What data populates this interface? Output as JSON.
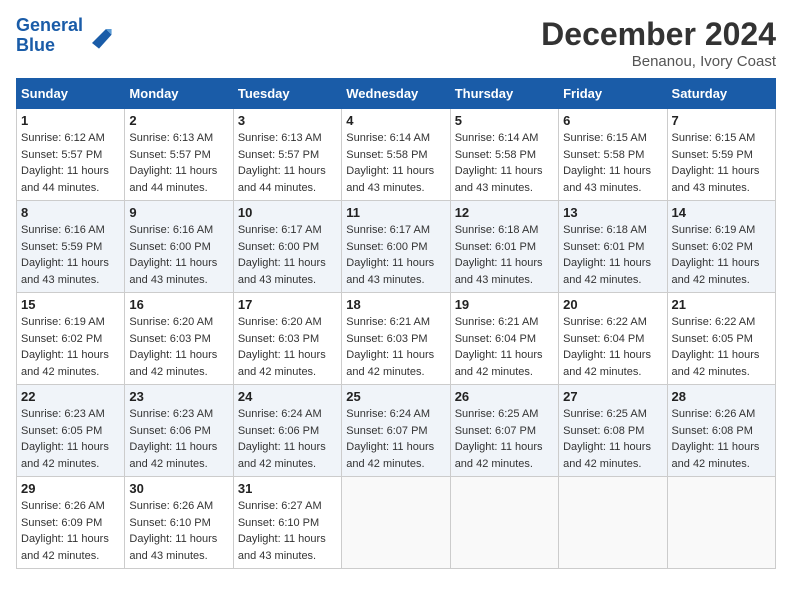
{
  "header": {
    "logo_line1": "General",
    "logo_line2": "Blue",
    "month_title": "December 2024",
    "subtitle": "Benanou, Ivory Coast"
  },
  "days_of_week": [
    "Sunday",
    "Monday",
    "Tuesday",
    "Wednesday",
    "Thursday",
    "Friday",
    "Saturday"
  ],
  "weeks": [
    [
      {
        "day": "1",
        "sunrise": "6:12 AM",
        "sunset": "5:57 PM",
        "daylight": "11 hours and 44 minutes."
      },
      {
        "day": "2",
        "sunrise": "6:13 AM",
        "sunset": "5:57 PM",
        "daylight": "11 hours and 44 minutes."
      },
      {
        "day": "3",
        "sunrise": "6:13 AM",
        "sunset": "5:57 PM",
        "daylight": "11 hours and 44 minutes."
      },
      {
        "day": "4",
        "sunrise": "6:14 AM",
        "sunset": "5:58 PM",
        "daylight": "11 hours and 43 minutes."
      },
      {
        "day": "5",
        "sunrise": "6:14 AM",
        "sunset": "5:58 PM",
        "daylight": "11 hours and 43 minutes."
      },
      {
        "day": "6",
        "sunrise": "6:15 AM",
        "sunset": "5:58 PM",
        "daylight": "11 hours and 43 minutes."
      },
      {
        "day": "7",
        "sunrise": "6:15 AM",
        "sunset": "5:59 PM",
        "daylight": "11 hours and 43 minutes."
      }
    ],
    [
      {
        "day": "8",
        "sunrise": "6:16 AM",
        "sunset": "5:59 PM",
        "daylight": "11 hours and 43 minutes."
      },
      {
        "day": "9",
        "sunrise": "6:16 AM",
        "sunset": "6:00 PM",
        "daylight": "11 hours and 43 minutes."
      },
      {
        "day": "10",
        "sunrise": "6:17 AM",
        "sunset": "6:00 PM",
        "daylight": "11 hours and 43 minutes."
      },
      {
        "day": "11",
        "sunrise": "6:17 AM",
        "sunset": "6:00 PM",
        "daylight": "11 hours and 43 minutes."
      },
      {
        "day": "12",
        "sunrise": "6:18 AM",
        "sunset": "6:01 PM",
        "daylight": "11 hours and 43 minutes."
      },
      {
        "day": "13",
        "sunrise": "6:18 AM",
        "sunset": "6:01 PM",
        "daylight": "11 hours and 42 minutes."
      },
      {
        "day": "14",
        "sunrise": "6:19 AM",
        "sunset": "6:02 PM",
        "daylight": "11 hours and 42 minutes."
      }
    ],
    [
      {
        "day": "15",
        "sunrise": "6:19 AM",
        "sunset": "6:02 PM",
        "daylight": "11 hours and 42 minutes."
      },
      {
        "day": "16",
        "sunrise": "6:20 AM",
        "sunset": "6:03 PM",
        "daylight": "11 hours and 42 minutes."
      },
      {
        "day": "17",
        "sunrise": "6:20 AM",
        "sunset": "6:03 PM",
        "daylight": "11 hours and 42 minutes."
      },
      {
        "day": "18",
        "sunrise": "6:21 AM",
        "sunset": "6:03 PM",
        "daylight": "11 hours and 42 minutes."
      },
      {
        "day": "19",
        "sunrise": "6:21 AM",
        "sunset": "6:04 PM",
        "daylight": "11 hours and 42 minutes."
      },
      {
        "day": "20",
        "sunrise": "6:22 AM",
        "sunset": "6:04 PM",
        "daylight": "11 hours and 42 minutes."
      },
      {
        "day": "21",
        "sunrise": "6:22 AM",
        "sunset": "6:05 PM",
        "daylight": "11 hours and 42 minutes."
      }
    ],
    [
      {
        "day": "22",
        "sunrise": "6:23 AM",
        "sunset": "6:05 PM",
        "daylight": "11 hours and 42 minutes."
      },
      {
        "day": "23",
        "sunrise": "6:23 AM",
        "sunset": "6:06 PM",
        "daylight": "11 hours and 42 minutes."
      },
      {
        "day": "24",
        "sunrise": "6:24 AM",
        "sunset": "6:06 PM",
        "daylight": "11 hours and 42 minutes."
      },
      {
        "day": "25",
        "sunrise": "6:24 AM",
        "sunset": "6:07 PM",
        "daylight": "11 hours and 42 minutes."
      },
      {
        "day": "26",
        "sunrise": "6:25 AM",
        "sunset": "6:07 PM",
        "daylight": "11 hours and 42 minutes."
      },
      {
        "day": "27",
        "sunrise": "6:25 AM",
        "sunset": "6:08 PM",
        "daylight": "11 hours and 42 minutes."
      },
      {
        "day": "28",
        "sunrise": "6:26 AM",
        "sunset": "6:08 PM",
        "daylight": "11 hours and 42 minutes."
      }
    ],
    [
      {
        "day": "29",
        "sunrise": "6:26 AM",
        "sunset": "6:09 PM",
        "daylight": "11 hours and 42 minutes."
      },
      {
        "day": "30",
        "sunrise": "6:26 AM",
        "sunset": "6:10 PM",
        "daylight": "11 hours and 43 minutes."
      },
      {
        "day": "31",
        "sunrise": "6:27 AM",
        "sunset": "6:10 PM",
        "daylight": "11 hours and 43 minutes."
      },
      null,
      null,
      null,
      null
    ]
  ],
  "labels": {
    "sunrise": "Sunrise:",
    "sunset": "Sunset:",
    "daylight": "Daylight:"
  }
}
